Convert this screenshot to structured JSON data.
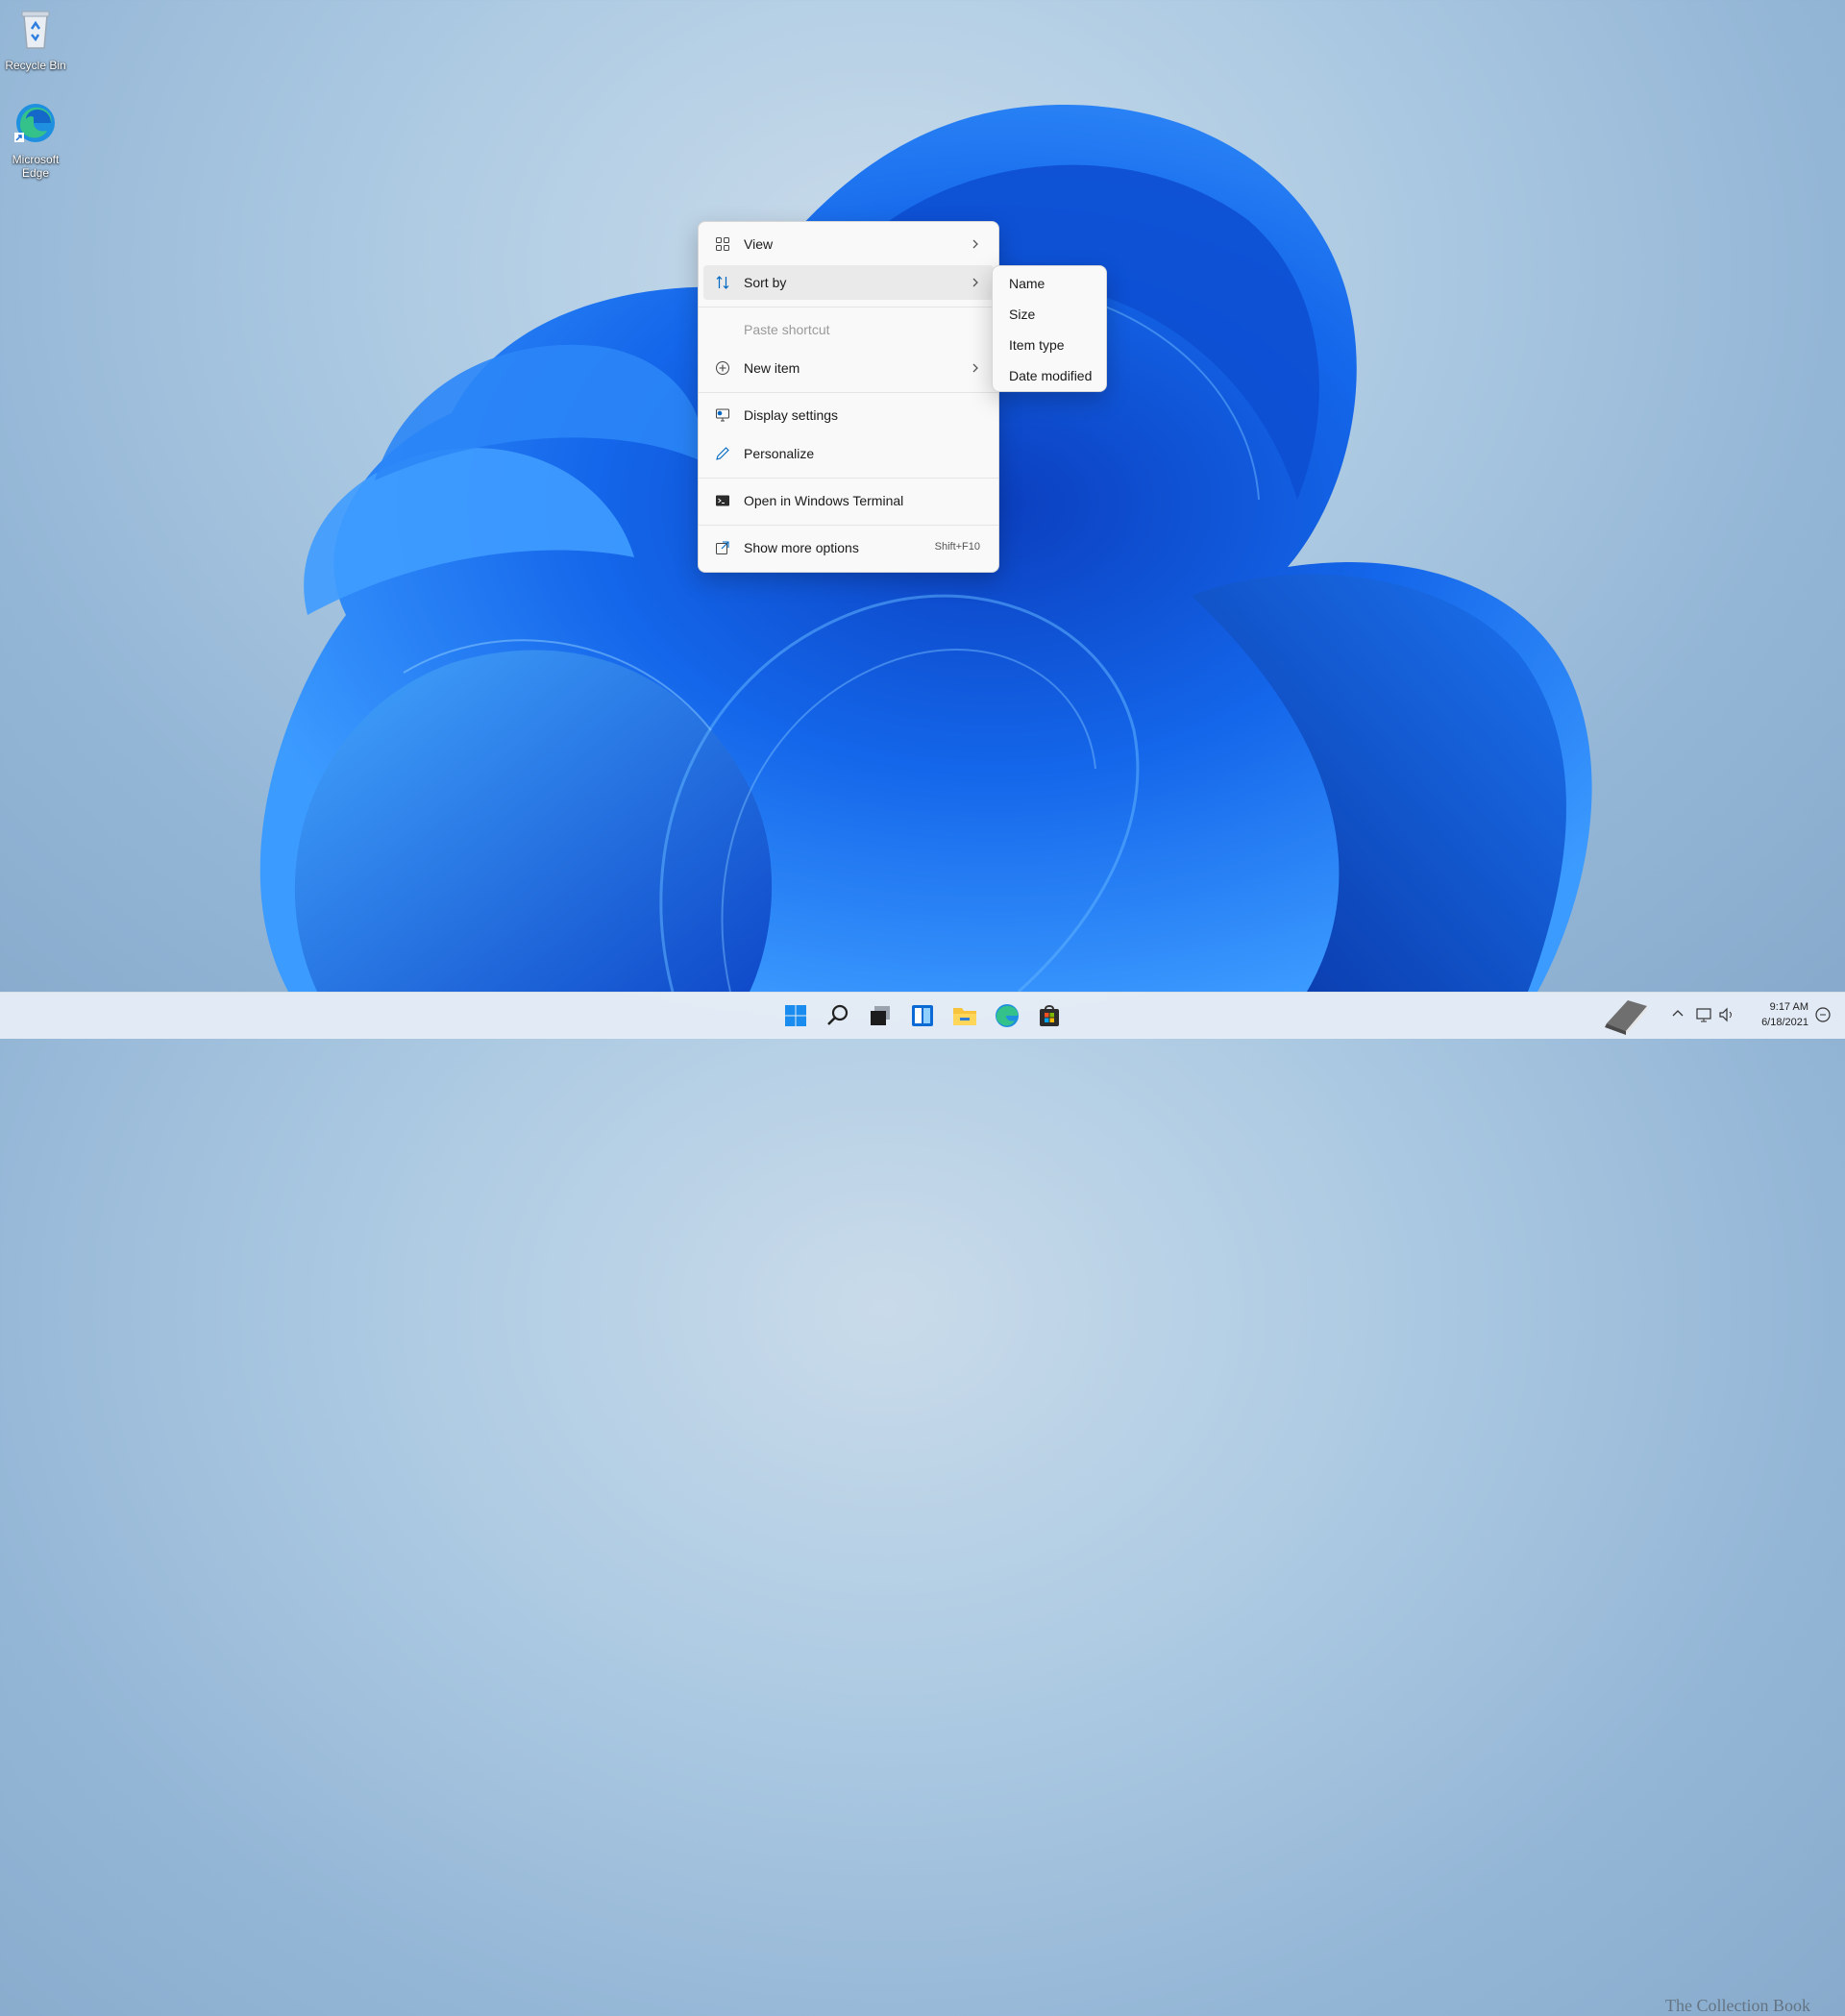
{
  "desktop": {
    "icons": [
      {
        "label": "Recycle Bin",
        "icon": "recycle-bin-icon"
      },
      {
        "label_line1": "Microsoft",
        "label_line2": "Edge",
        "icon": "edge-icon"
      }
    ]
  },
  "context_menu": {
    "items": [
      {
        "label": "View",
        "icon": "grid-view-icon",
        "submenu": true
      },
      {
        "label": "Sort by",
        "icon": "sort-arrows-icon",
        "submenu": true,
        "highlighted": true
      },
      {
        "label": "Paste shortcut",
        "disabled": true
      },
      {
        "label": "New item",
        "icon": "plus-circle-icon",
        "submenu": true
      },
      {
        "label": "Display settings",
        "icon": "display-settings-icon"
      },
      {
        "label": "Personalize",
        "icon": "pen-icon"
      },
      {
        "label": "Open in Windows Terminal",
        "icon": "terminal-icon"
      },
      {
        "label": "Show more options",
        "icon": "open-external-icon",
        "shortcut": "Shift+F10"
      }
    ]
  },
  "sort_submenu": {
    "items": [
      "Name",
      "Size",
      "Item type",
      "Date modified"
    ]
  },
  "taskbar": {
    "apps": [
      "start-icon",
      "search-icon",
      "task-view-icon",
      "widgets-icon",
      "file-explorer-icon",
      "edge-icon",
      "store-icon"
    ],
    "tray": {
      "time": "9:17 AM",
      "date": "6/18/2021"
    }
  },
  "watermark": "The Collection Book",
  "colors": {
    "accent": "#0067c0",
    "menu_bg": "#f9f9f9",
    "wallpaper_blue": "#1565e8"
  }
}
